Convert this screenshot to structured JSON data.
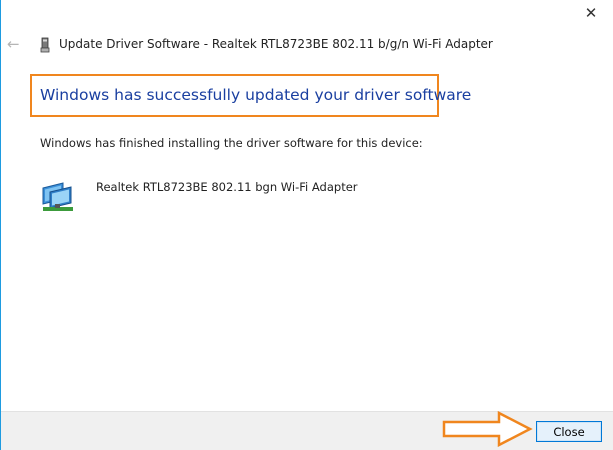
{
  "window": {
    "close_glyph": "✕",
    "back_glyph": "←",
    "title": "Update Driver Software - Realtek RTL8723BE 802.11 b/g/n Wi-Fi Adapter"
  },
  "main": {
    "headline": "Windows has successfully updated your driver software",
    "finished_text": "Windows has finished installing the driver software for this device:",
    "device_name": "Realtek RTL8723BE 802.11 bgn Wi-Fi Adapter",
    "device_icon": "network-adapter-icon"
  },
  "footer": {
    "close_label": "Close"
  },
  "colors": {
    "headline": "#1a3fa0",
    "highlight": "#f0861e",
    "button_border": "#0078d7",
    "button_fill": "#e5f1fb"
  }
}
